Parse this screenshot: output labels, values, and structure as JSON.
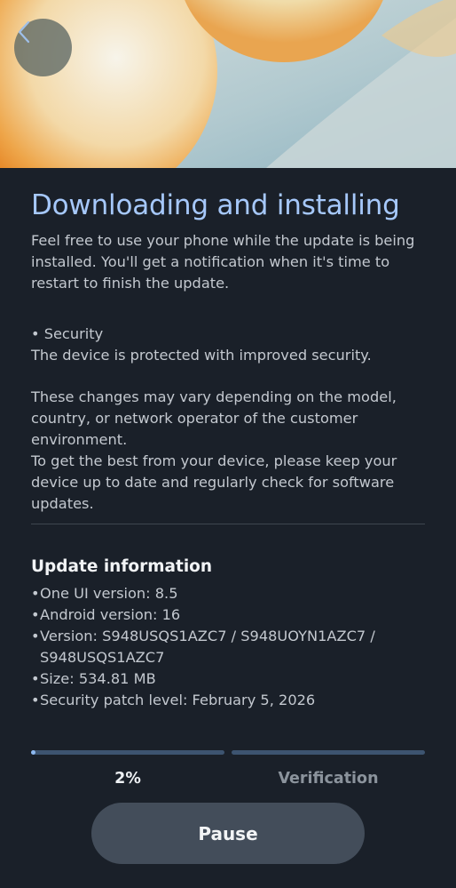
{
  "header": {
    "back_icon": "chevron-left-icon"
  },
  "main": {
    "title": "Downloading and installing",
    "intro": "Feel free to use your phone while the update is being installed. You'll get a notification when it's time to restart to finish the update.",
    "security_heading": "• Security",
    "security_text": "The device is protected with improved security.",
    "vary_text": "These changes may vary depending on the model, country, or network operator of the customer environment.",
    "best_text": "To get the best from your device, please keep your device up to date and regularly check for software updates."
  },
  "update_info": {
    "title": "Update information",
    "items": [
      "One UI version: 8.5",
      "Android version: 16",
      "Version: S948USQS1AZC7 / S948UOYN1AZC7 / S948USQS1AZC7",
      "Size: 534.81 MB",
      "Security patch level: February 5, 2026"
    ]
  },
  "progress": {
    "download_fraction": 0.02,
    "verification_fraction": 0.0,
    "percent_label": "2%",
    "verification_label": "Verification"
  },
  "actions": {
    "pause_label": "Pause"
  },
  "colors": {
    "background": "#1a2029",
    "title_accent": "#a6c8fa",
    "progress_fill": "#8db8ef",
    "progress_track": "#3d5470",
    "button_bg": "#434d5a"
  }
}
